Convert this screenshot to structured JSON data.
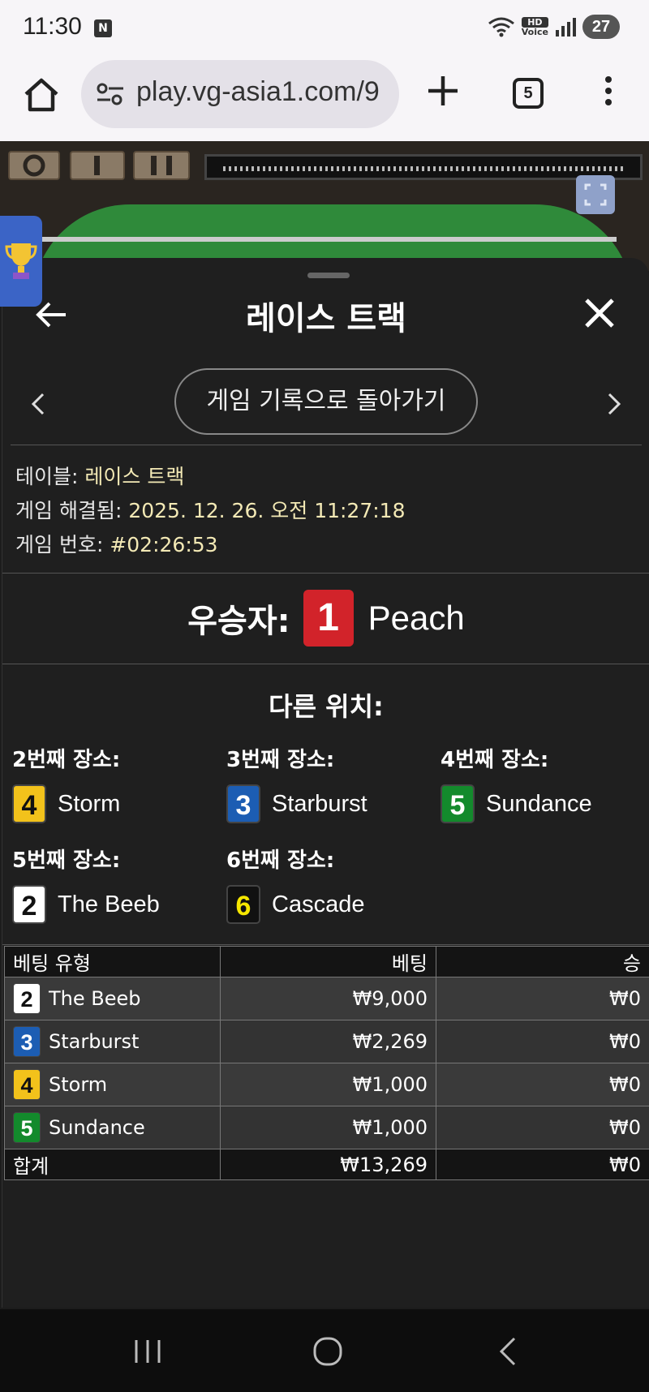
{
  "status_bar": {
    "time": "11:30",
    "notification_badge": "N",
    "hd_label_1": "HD",
    "hd_label_2": "Voice",
    "battery": "27"
  },
  "browser": {
    "url": "play.vg-asia1.com/9",
    "tab_count": "5"
  },
  "sheet": {
    "title": "레이스 트랙",
    "back_to_history": "게임 기록으로 돌아가기",
    "meta": [
      {
        "label": "테이블: ",
        "value": "레이스 트랙"
      },
      {
        "label": "게임 해결됨: ",
        "value": "2025. 12. 26. 오전 11:27:18"
      },
      {
        "label": "게임 번호: ",
        "value": "#02:26:53"
      }
    ],
    "winner_label": "우승자:",
    "winner": {
      "number": "1",
      "name": "Peach",
      "bg": "#d2232a",
      "fg": "#ffffff"
    },
    "others_title": "다른 위치:",
    "places": [
      {
        "label": "2번째 장소:",
        "number": "4",
        "name": "Storm",
        "bg": "#f2c21b",
        "fg": "#111111"
      },
      {
        "label": "3번째 장소:",
        "number": "3",
        "name": "Starburst",
        "bg": "#1c5db3",
        "fg": "#ffffff"
      },
      {
        "label": "4번째 장소:",
        "number": "5",
        "name": "Sundance",
        "bg": "#138a2c",
        "fg": "#ffffff"
      },
      {
        "label": "5번째 장소:",
        "number": "2",
        "name": "The Beeb",
        "bg": "#ffffff",
        "fg": "#111111"
      },
      {
        "label": "6번째 장소:",
        "number": "6",
        "name": "Cascade",
        "bg": "#111111",
        "fg": "#f5e600"
      }
    ],
    "table": {
      "headers": [
        "베팅 유형",
        "베팅",
        "승"
      ],
      "rows": [
        {
          "number": "2",
          "name": "The Beeb",
          "bet": "₩9,000",
          "win": "₩0",
          "bg": "#ffffff",
          "fg": "#111111"
        },
        {
          "number": "3",
          "name": "Starburst",
          "bet": "₩2,269",
          "win": "₩0",
          "bg": "#1c5db3",
          "fg": "#ffffff"
        },
        {
          "number": "4",
          "name": "Storm",
          "bet": "₩1,000",
          "win": "₩0",
          "bg": "#f2c21b",
          "fg": "#111111"
        },
        {
          "number": "5",
          "name": "Sundance",
          "bet": "₩1,000",
          "win": "₩0",
          "bg": "#138a2c",
          "fg": "#ffffff"
        }
      ],
      "total": {
        "label": "합계",
        "bet": "₩13,269",
        "win": "₩0"
      }
    }
  },
  "icons": [
    "home-icon",
    "tune-icon",
    "plus-icon",
    "tabs-icon",
    "more-vert-icon",
    "back-arrow-icon",
    "close-icon",
    "chevron-left-icon",
    "chevron-right-icon",
    "expand-icon",
    "trophy-icon",
    "recents-icon",
    "home-circle-icon",
    "back-icon"
  ]
}
